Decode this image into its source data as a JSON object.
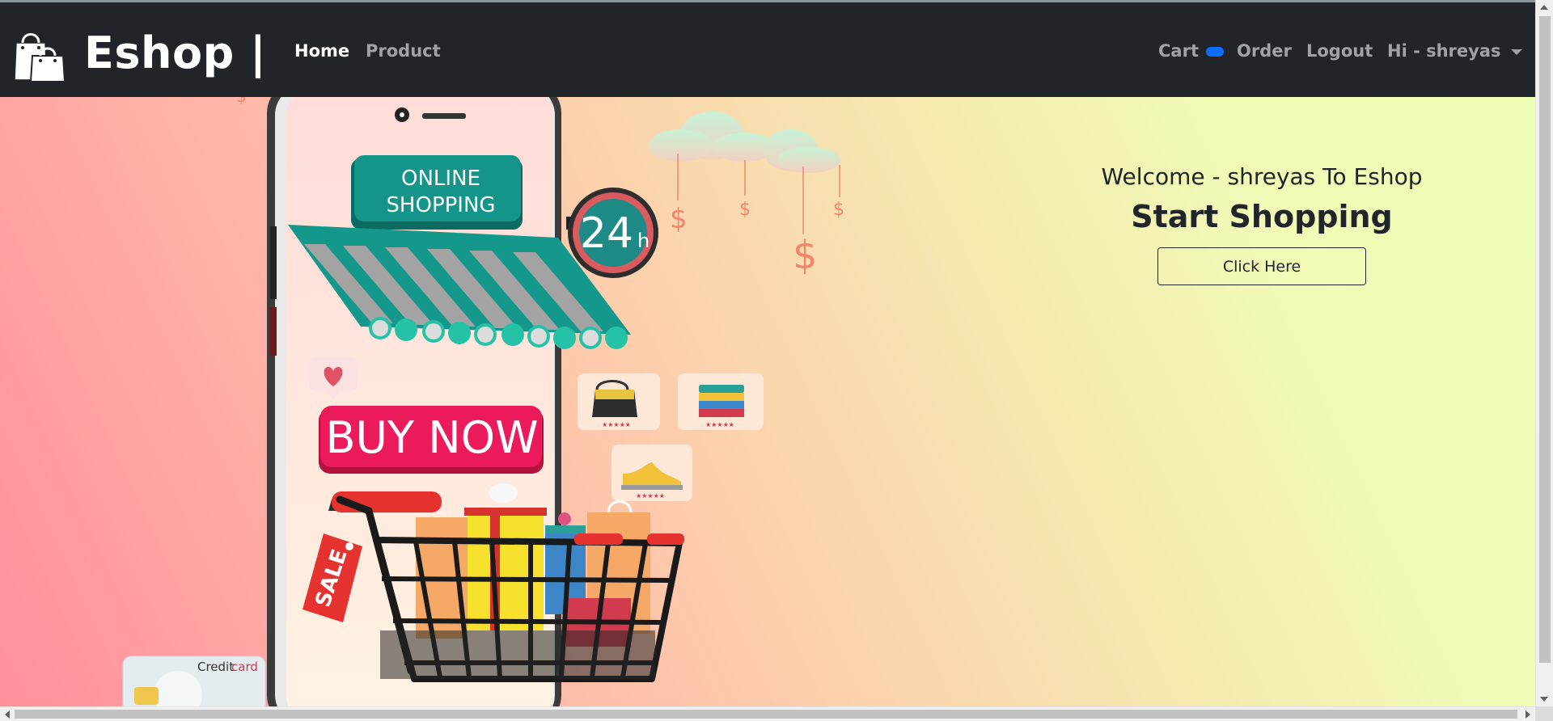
{
  "navbar": {
    "brand": "Eshop |",
    "links": {
      "home": "Home",
      "product": "Product",
      "cart": "Cart",
      "order": "Order",
      "logout": "Logout",
      "user": "Hi - shreyas"
    },
    "icons": {
      "brand": "shopping-bags-icon",
      "user_menu": "caret-down-icon"
    }
  },
  "hero": {
    "welcome": "Welcome - shreyas To Eshop",
    "headline": "Start Shopping",
    "button_label": "Click Here",
    "illustration": {
      "sign": [
        "ONLINE",
        "SHOPPING"
      ],
      "hours": "24",
      "hours_suffix": "h",
      "buy_now": "BUY NOW",
      "sale": "SALE",
      "stars": "★★★★★",
      "card": [
        "Credit",
        "card"
      ],
      "currency": "$"
    }
  },
  "colors": {
    "navbar_bg": "#212529",
    "nav_active": "#ffffff",
    "nav_muted": "#9ea3a8",
    "cart_badge": "#0d6efd",
    "gradient_start": "#ff8f9c",
    "gradient_end": "#eefeb6",
    "text_dark": "#212529"
  }
}
